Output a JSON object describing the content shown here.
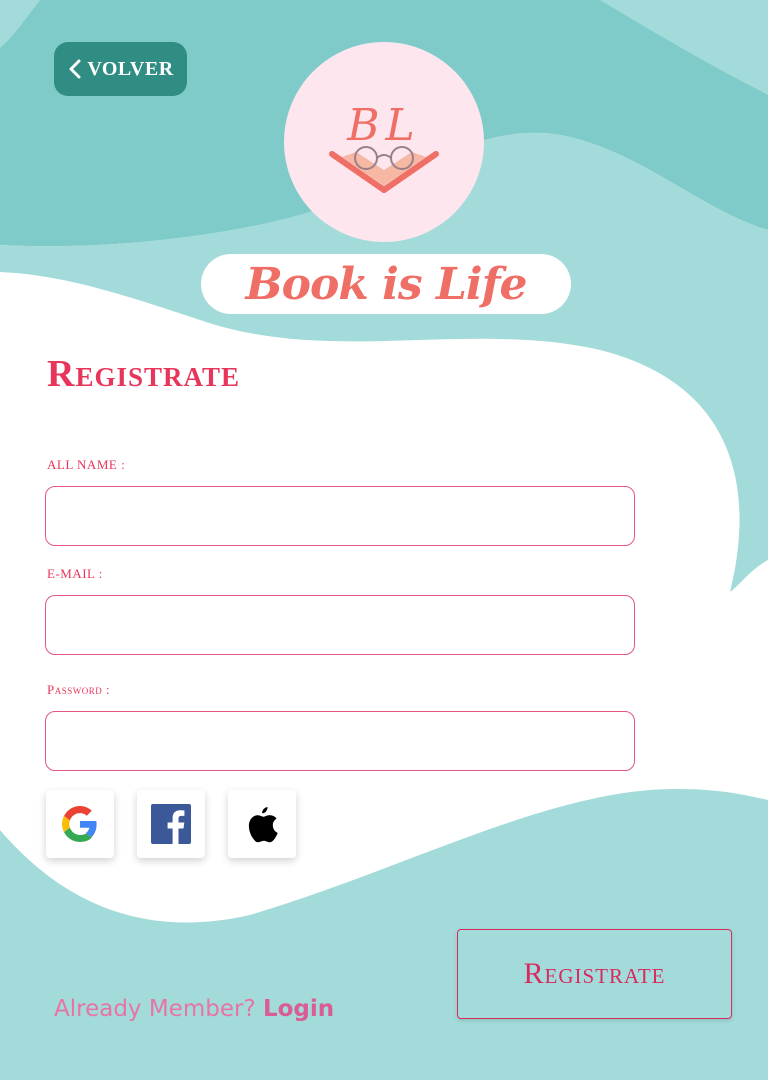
{
  "header": {
    "back_label": "VOLVER",
    "logo_monogram": "BL",
    "brand_name": "Book is Life"
  },
  "form": {
    "title": "Registrate",
    "fields": [
      {
        "label": "ALL NAME :",
        "value": "",
        "placeholder": ""
      },
      {
        "label": "E-MAIL :",
        "value": "",
        "placeholder": ""
      },
      {
        "label": "Password :",
        "value": "",
        "placeholder": ""
      }
    ],
    "social_icons": [
      "google-icon",
      "facebook-icon",
      "apple-icon"
    ]
  },
  "footer": {
    "member_question": "Already Member?",
    "login_label": "Login",
    "register_label": "Registrate"
  },
  "colors": {
    "teal_dark": "#7fcbc9",
    "teal_light": "#a3dbda",
    "button_teal": "#2f8d83",
    "accent_red": "#e8355b",
    "brand_coral": "#ef6f66",
    "logo_pink": "#fde6ee"
  }
}
